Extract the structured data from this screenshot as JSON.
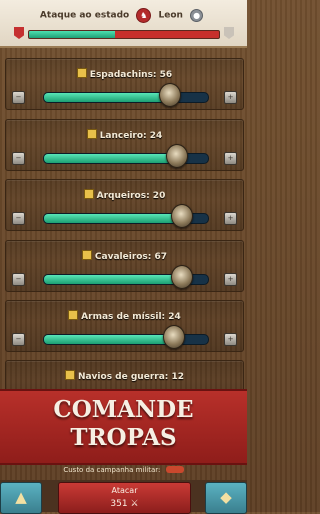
{
  "header": {
    "title": "Ataque ao estado",
    "opponent": "Leon",
    "progress_fraction": 0.45
  },
  "units": [
    {
      "label": "Espadachins: 56",
      "fill": 0.77
    },
    {
      "label": "Lanceiro: 24",
      "fill": 0.81
    },
    {
      "label": "Arqueiros: 20",
      "fill": 0.84
    },
    {
      "label": "Cavaleiros: 67",
      "fill": 0.84
    },
    {
      "label": "Armas de míssil: 24",
      "fill": 0.79
    },
    {
      "label": "Navios de guerra: 12",
      "fill": 0.8
    }
  ],
  "banner": {
    "line1": "COMANDE",
    "line2": "TROPAS"
  },
  "cost": {
    "label": "Custo da campanha militar:"
  },
  "footer": {
    "attack_label": "Atacar",
    "attack_value": "351"
  },
  "colors": {
    "accent_green": "#2fbf8b",
    "enemy_red": "#c7302c",
    "banner_red": "#a8271f"
  }
}
